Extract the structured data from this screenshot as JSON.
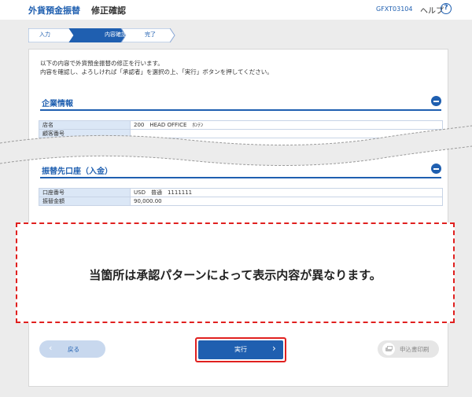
{
  "header": {
    "app_title": "外貨預金振替",
    "screen_title": "修正確認",
    "screen_id": "GFXT03104",
    "help_label": "ヘルプ",
    "help_icon": "help-circle-icon"
  },
  "steps": [
    {
      "label": "入力",
      "state": "done"
    },
    {
      "label": "内容確認",
      "state": "current"
    },
    {
      "label": "完了",
      "state": "pending"
    }
  ],
  "intro": {
    "line1": "以下の内容で外貨預金振替の修正を行います。",
    "line2": "内容を確認し、よろしければ「承認者」を選択の上、「実行」ボタンを押してください。"
  },
  "company_info": {
    "title": "企業情報",
    "icon": "collapse-icon",
    "rows": [
      {
        "label": "店名",
        "value": "200　HEAD OFFICE　ﾎﾝﾃﾝ"
      },
      {
        "label": "顧客番号",
        "value": ""
      }
    ]
  },
  "destination_account": {
    "title": "振替先口座（入金）",
    "icon": "collapse-icon",
    "rows": [
      {
        "label": "口座番号",
        "value": "USD　普通　1111111"
      },
      {
        "label": "振替金額",
        "value": "90,000.00"
      }
    ]
  },
  "notice": {
    "text": "当箇所は承認パターンによって表示内容が異なります。"
  },
  "buttons": {
    "back_label": "戻る",
    "execute_label": "実行",
    "print_label": "申込書印刷"
  },
  "colors": {
    "accent": "#1f5fb0",
    "highlight": "#e0201f",
    "table_header": "#dbe7f6"
  }
}
